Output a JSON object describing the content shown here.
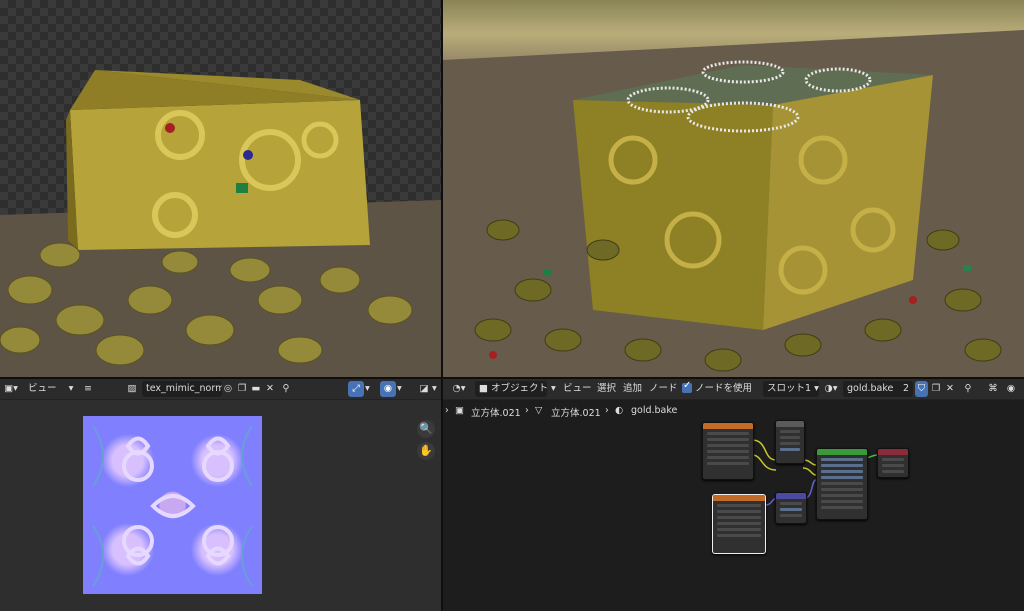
{
  "image_editor": {
    "view_menu": "ビュー",
    "image_name": "tex_mimic_normal",
    "icons": [
      "image-type-icon",
      "view-icon",
      "hamburger-icon",
      "image-browse-icon",
      "fake-user-icon",
      "duplicate-icon",
      "open-folder-icon",
      "close-icon",
      "pin-icon",
      "uv-sync-icon",
      "overlay-icon",
      "display-channel-icon"
    ],
    "tools": [
      "zoom-icon",
      "hand-pan-icon"
    ]
  },
  "node_editor": {
    "mode": "オブジェクト",
    "menus": [
      "ビュー",
      "選択",
      "追加",
      "ノード"
    ],
    "use_nodes_label": "ノードを使用",
    "use_nodes_checked": true,
    "slot": "スロット1",
    "material_name": "gold.bake",
    "user_count": "2",
    "breadcrumb": {
      "object": "立方体.021",
      "mesh": "立方体.021",
      "material": "gold.bake"
    }
  },
  "colors": {
    "accent_blue": "#4772b3",
    "header_bg": "#2b2b2b",
    "editor_bg": "#1d1d1d"
  }
}
